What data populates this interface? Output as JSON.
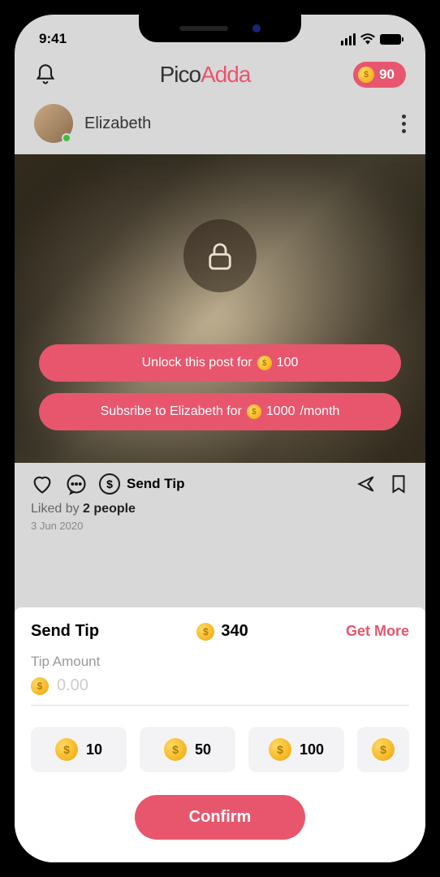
{
  "status": {
    "time": "9:41"
  },
  "header": {
    "brand_a": "Pico",
    "brand_b": "Adda",
    "coin_balance": "90"
  },
  "user": {
    "name": "Elizabeth"
  },
  "post": {
    "unlock_prefix": "Unlock this post for",
    "unlock_cost": "100",
    "subscribe_prefix": "Subsribe to Elizabeth for",
    "subscribe_cost": "1000",
    "subscribe_suffix": "/month",
    "send_tip_label": "Send Tip",
    "liked_prefix": "Liked  by ",
    "liked_count": "2 people",
    "date": "3 Jun 2020"
  },
  "tip_sheet": {
    "title": "Send Tip",
    "balance": "340",
    "get_more": "Get More",
    "amount_label": "Tip Amount",
    "placeholder": "0.00",
    "presets": [
      "10",
      "50",
      "100"
    ],
    "confirm": "Confirm"
  }
}
